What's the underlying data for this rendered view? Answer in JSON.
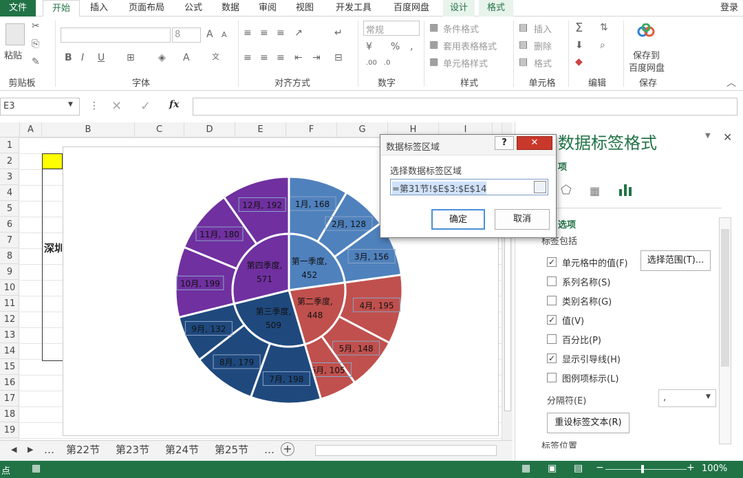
{
  "tabs": {
    "file": "文件",
    "home": "开始",
    "insert": "插入",
    "layout": "页面布局",
    "formula": "公式",
    "data": "数据",
    "review": "审阅",
    "view": "视图",
    "dev": "开发工具",
    "baidu": "百度网盘",
    "design": "设计",
    "format": "格式",
    "login": "登录"
  },
  "ribbon": {
    "paste": "粘贴",
    "font_size": "8",
    "number_format": "常规",
    "cond_format": "条件格式",
    "table_format": "套用表格格式",
    "cell_style": "单元格样式",
    "insert_cells": "插入",
    "delete_cells": "删除",
    "format_cells": "格式",
    "save_to": "保存到",
    "baidu_disk": "百度网盘",
    "groups": {
      "clipboard": "剪贴板",
      "font": "字体",
      "align": "对齐方式",
      "number": "数字",
      "style": "样式",
      "cells": "单元格",
      "edit": "编辑",
      "save": "保存"
    }
  },
  "formula_bar": {
    "name_box": "E3",
    "fx": "fx"
  },
  "columns": [
    "A",
    "B",
    "C",
    "D",
    "E",
    "F",
    "G",
    "H",
    "I"
  ],
  "rows": [
    "1",
    "2",
    "3",
    "4",
    "5",
    "6",
    "7",
    "8",
    "9",
    "10",
    "11",
    "12",
    "13",
    "14",
    "15",
    "16",
    "17",
    "18",
    "19"
  ],
  "cell_text": "深圳",
  "sheets": [
    "第22节",
    "第23节",
    "第24节",
    "第25节"
  ],
  "sheet_nav": {
    "ellipsis": "…"
  },
  "status": {
    "mode": "点",
    "zoom": "100%"
  },
  "chart_data": {
    "type": "sunburst",
    "inner": [
      {
        "label": "第一季度,",
        "value": 452,
        "color": "#4f81bd"
      },
      {
        "label": "第二季度,",
        "value": 448,
        "color": "#c0504d"
      },
      {
        "label": "第三季度,",
        "value": 509,
        "color": "#1f497d"
      },
      {
        "label": "第四季度,",
        "value": 571,
        "color": "#7030a0"
      }
    ],
    "outer": [
      {
        "label": "1月, 168",
        "value": 168,
        "color": "#4f81bd"
      },
      {
        "label": "2月, 128",
        "value": 128,
        "color": "#4f81bd"
      },
      {
        "label": "3月, 156",
        "value": 156,
        "color": "#4f81bd"
      },
      {
        "label": "4月, 195",
        "value": 195,
        "color": "#c0504d"
      },
      {
        "label": "5月, 148",
        "value": 148,
        "color": "#c0504d"
      },
      {
        "label": "6月, 105",
        "value": 105,
        "color": "#c0504d"
      },
      {
        "label": "7月, 198",
        "value": 198,
        "color": "#1f497d"
      },
      {
        "label": "8月, 179",
        "value": 179,
        "color": "#1f497d"
      },
      {
        "label": "9月, 132",
        "value": 132,
        "color": "#1f497d"
      },
      {
        "label": "10月, 199",
        "value": 199,
        "color": "#7030a0"
      },
      {
        "label": "11月, 180",
        "value": 180,
        "color": "#7030a0"
      },
      {
        "label": "12月, 192",
        "value": 192,
        "color": "#7030a0"
      }
    ]
  },
  "pane": {
    "title": "数据标签格式",
    "section_partial": "项",
    "label_options": "选项",
    "label_contains": "标签包括",
    "options": [
      {
        "text": "单元格中的值(F)",
        "checked": true
      },
      {
        "text": "系列名称(S)",
        "checked": false
      },
      {
        "text": "类别名称(G)",
        "checked": false
      },
      {
        "text": "值(V)",
        "checked": true
      },
      {
        "text": "百分比(P)",
        "checked": false
      },
      {
        "text": "显示引导线(H)",
        "checked": true
      },
      {
        "text": "图例项标示(L)",
        "checked": false
      }
    ],
    "select_range": "选择范围(T)...",
    "separator_label": "分隔符(E)",
    "separator_value": ",",
    "reset_label": "重设标签文本(R)",
    "label_position": "标签位置",
    "check": "✓"
  },
  "dialog": {
    "title": "数据标签区域",
    "prompt": "选择数据标签区域",
    "value": "=第31节!$E$3:$E$14",
    "ok": "确定",
    "cancel": "取消",
    "help": "?",
    "close": "✕"
  }
}
